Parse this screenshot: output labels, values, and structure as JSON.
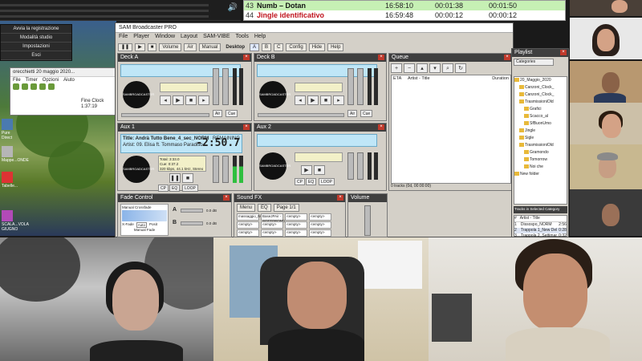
{
  "top_strip": {
    "volume_icon": "speaker-icon"
  },
  "playlist_strip": {
    "rows": [
      {
        "num": "43",
        "title": "Numb – Dotan",
        "start": "16:58:10",
        "length": "00:01:38",
        "end": "00:01:50",
        "bg": "#c6f0b4",
        "color": "#111111"
      },
      {
        "num": "44",
        "title": "Jingle identificativo",
        "start": "16:59:48",
        "length": "00:00:12",
        "end": "00:00:12",
        "bg": "#ffffff",
        "color": "#c0141e"
      }
    ]
  },
  "desktop": {
    "context_menu": [
      "Avvia la registrazione",
      "Modalità studio",
      "Impostazioni",
      "Esci"
    ],
    "explorer": {
      "title": "orecchietti 20 maggio 2020...",
      "menu": [
        "File",
        "Timer",
        "Opzioni",
        "Aiuto"
      ],
      "item_name": "Fine Clock",
      "item_time": "1:37:19"
    },
    "icons": [
      {
        "label": "Pure Direct"
      },
      {
        "label": "Mappe...ONDE"
      },
      {
        "label": "Tabelle..."
      },
      {
        "label": "SCALA...VOLA GIUGNO"
      }
    ]
  },
  "sam": {
    "title": "SAM Broadcaster PRO",
    "menu": [
      "File",
      "Player",
      "Window",
      "Layout",
      "SAM-VIBE",
      "Tools",
      "Help"
    ],
    "toolbar": {
      "volume_label": "Volume",
      "air_label": "Air",
      "mode_label": "Manual",
      "desktop_label": "Desktop",
      "tabs": [
        "A",
        "B",
        "C"
      ],
      "config": "Config",
      "hide": "Hide",
      "help": "Help"
    },
    "deck_a": {
      "title": "Deck A",
      "logo": "SAMBROADCASTER"
    },
    "deck_b": {
      "title": "Deck B",
      "logo": "SAMBROADCASTER"
    },
    "aux1": {
      "title": "Aux 1",
      "track_title": "Title: Andrà Tutto Bene_4_sec_NORM",
      "artist": "Artist: 09. Elisa ft. Tommaso Paradiso",
      "remaining_label": "REMAINING",
      "remaining": "-2:50.7",
      "total": "Total: 3:33.0",
      "cue": "Cue: 0:37.2",
      "format": "320 kbps, 44.1 kHz, Stereo",
      "logo": "SAMBROADCASTER"
    },
    "aux2": {
      "title": "Aux 2",
      "logo": "SAMBROADCASTER"
    },
    "queue": {
      "title": "Queue",
      "cols": [
        "ETA",
        "Artist - Title",
        "Duration"
      ],
      "footer": "0 tracks (0d, 00:00:00)"
    },
    "fade_control": {
      "title": "Fade Control",
      "mode": "Manual Crossfade",
      "xfade": "X-Fade",
      "auto": "Auto",
      "pos": "Posit",
      "manual_fade": "Manual Fade",
      "ch_a": "A",
      "ch_b": "B",
      "db1": "0.0 dB",
      "db2": "0.0 dB"
    },
    "sound_fx": {
      "title": "Sound FX",
      "menu": "Menu",
      "eq": "EQ",
      "page": "Page 1/1",
      "volume": "Volume",
      "cells": [
        "massaggio_NORM",
        "BaseJPAir - SOTTOFOND",
        "<empty>",
        "<empty>",
        "<empty>",
        "<empty>",
        "<empty>",
        "<empty>",
        "<empty>",
        "<empty>",
        "<empty>",
        "<empty>"
      ]
    }
  },
  "playlist": {
    "title": "Playlist",
    "categories_btn": "Categories",
    "tree": [
      "20_Maggio_2020",
      "Canzoni_Clock_",
      "Canzoni_Clock_",
      "TrasmissioniOld",
      "Grafici",
      "Scacco_al",
      "SfBuonUmo",
      "Jingle",
      "Sigle",
      "TrasmissioniOld",
      "Gramondo",
      "Tomorrow",
      "Noi che",
      "New folder"
    ],
    "tracks_title": "Tracks in Selected Category",
    "tracks_cols": [
      "#",
      "Artist - Title"
    ],
    "tracks": [
      {
        "n": "1",
        "name": "Dissospo_NORM",
        "dur": "2:56"
      },
      {
        "n": "2",
        "name": "Trappola 1_New Dello_NORM",
        "dur": "0:28"
      },
      {
        "n": "3",
        "name": "Trappola 2_Settimana_NORM",
        "dur": "0:32"
      }
    ]
  },
  "video_participants": {
    "thumb_count": 6,
    "main_count": 3
  }
}
